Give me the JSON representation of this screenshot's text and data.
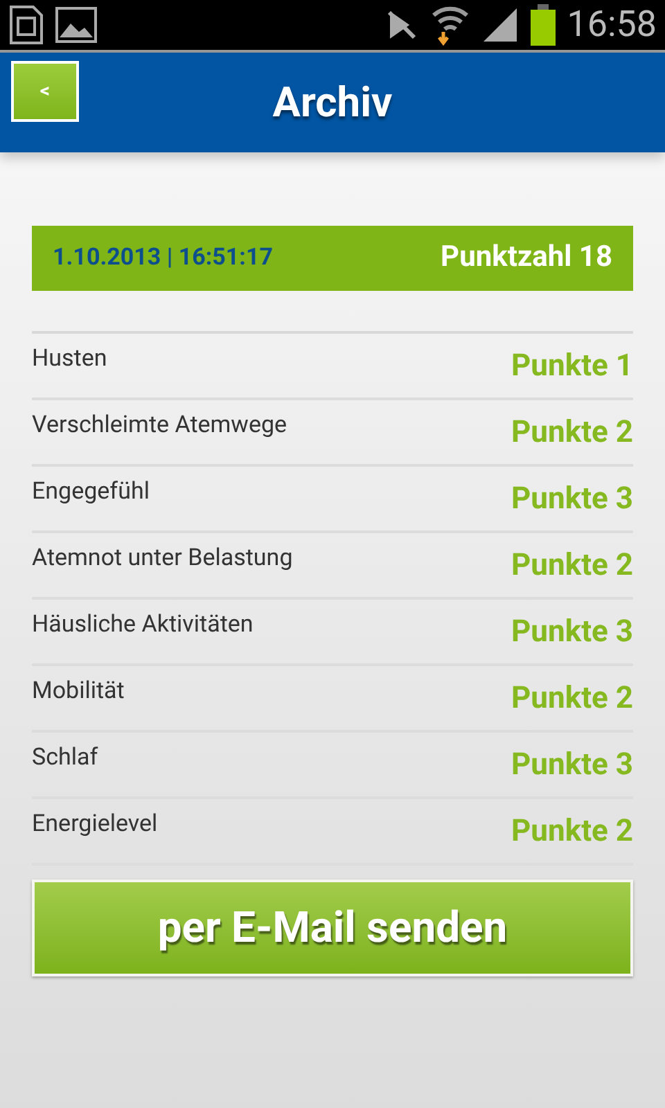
{
  "status_bar": {
    "time": "16:58"
  },
  "header": {
    "back": "<",
    "title": "Archiv"
  },
  "entry": {
    "datetime": "1.10.2013 | 16:51:17",
    "total": "Punktzahl 18"
  },
  "rows": [
    {
      "label": "Husten",
      "points": "Punkte 1"
    },
    {
      "label": "Verschleimte Atemwege",
      "points": "Punkte 2"
    },
    {
      "label": "Engegefühl",
      "points": "Punkte 3"
    },
    {
      "label": "Atemnot unter Belastung",
      "points": "Punkte 2"
    },
    {
      "label": "Häusliche Aktivitäten",
      "points": "Punkte 3"
    },
    {
      "label": "Mobilität",
      "points": "Punkte 2"
    },
    {
      "label": "Schlaf",
      "points": "Punkte 3"
    },
    {
      "label": "Energielevel",
      "points": "Punkte 2"
    }
  ],
  "send_button": "per E-Mail senden"
}
